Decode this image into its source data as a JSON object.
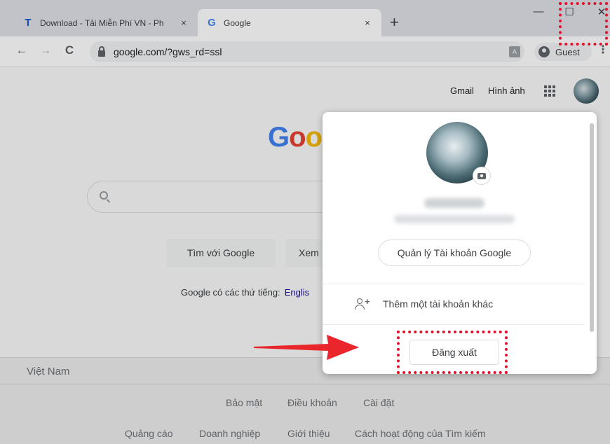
{
  "tabs": [
    {
      "favicon": "T",
      "title": "Download - Tải Miễn Phí VN - Ph",
      "close": "×"
    },
    {
      "favicon": "G",
      "title": "Google",
      "close": "×"
    }
  ],
  "new_tab": "+",
  "window_controls": {
    "minimize": "—",
    "maximize": "☐",
    "close": "✕"
  },
  "nav": {
    "back": "←",
    "forward": "→",
    "reload": "C"
  },
  "address": "google.com/?gws_rd=ssl",
  "profile_button": "Guest",
  "menu_icon": "⋮",
  "toplinks": {
    "gmail": "Gmail",
    "images": "Hình ảnh"
  },
  "logo": {
    "part1": "G",
    "part2": "o",
    "part3": "o"
  },
  "buttons": {
    "search": "Tìm với Google",
    "lucky": "Xem"
  },
  "language_line": {
    "text": "Google có các thứ tiếng:",
    "lang": "Englis"
  },
  "footer": {
    "country": "Việt Nam",
    "links_row1": [
      "Bảo mật",
      "Điều khoản",
      "Cài đặt"
    ],
    "links_row2": [
      "Quảng cáo",
      "Doanh nghiệp",
      "Giới thiệu",
      "Cách hoạt động của Tìm kiếm"
    ]
  },
  "account_popup": {
    "manage_button": "Quản lý Tài khoản Google",
    "add_account": "Thêm một tài khoản khác",
    "logout_button": "Đăng xuất"
  },
  "colors": {
    "highlight": "#e0112b",
    "arrow": "#e8262c",
    "link": "#1a0dab"
  }
}
